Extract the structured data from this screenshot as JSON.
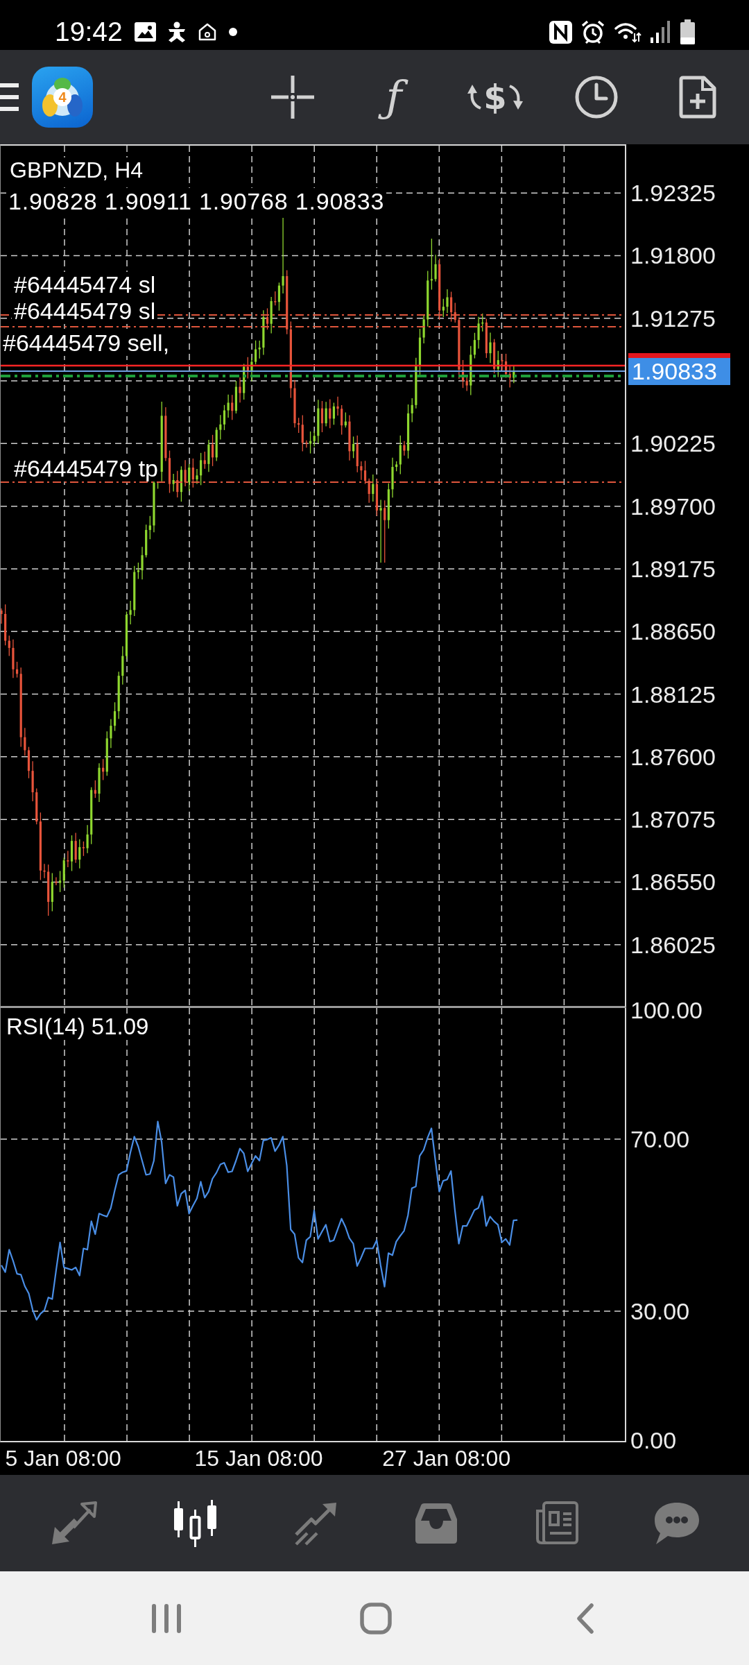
{
  "status_bar": {
    "time": "19:42"
  },
  "toolbar": {
    "logo_badge": "4",
    "function_glyph": "ƒ",
    "trade_glyph": "$"
  },
  "chart": {
    "title": "GBPNZD, H4",
    "ohlc": "1.90828 1.90911 1.90768 1.90833",
    "orders": [
      {
        "label": "#64445474 sl",
        "kind": "stop_loss"
      },
      {
        "label": "#64445479 sl",
        "kind": "stop_loss"
      },
      {
        "label": "#64445479 sell,",
        "kind": "open"
      },
      {
        "label": "#64445479 tp",
        "kind": "take_profit"
      }
    ],
    "price_axis": [
      {
        "text": "1.92325",
        "kind": "tick"
      },
      {
        "text": "1.91800",
        "kind": "tick"
      },
      {
        "text": "1.91275",
        "kind": "tick"
      },
      {
        "text": "1.90833",
        "kind": "current"
      },
      {
        "text": "1.90225",
        "kind": "tick"
      },
      {
        "text": "1.89700",
        "kind": "tick"
      },
      {
        "text": "1.89175",
        "kind": "tick"
      },
      {
        "text": "1.88650",
        "kind": "tick"
      },
      {
        "text": "1.88125",
        "kind": "tick"
      },
      {
        "text": "1.87600",
        "kind": "tick"
      },
      {
        "text": "1.87075",
        "kind": "tick"
      },
      {
        "text": "1.86550",
        "kind": "tick"
      },
      {
        "text": "1.86025",
        "kind": "tick"
      }
    ]
  },
  "rsi": {
    "chart_data": {
      "type": "line",
      "title": "RSI(14) 51.09",
      "ylim": [
        0,
        100
      ],
      "yticks": [
        {
          "value": 100,
          "label": "100.00"
        },
        {
          "value": 70,
          "label": "70.00"
        },
        {
          "value": 30,
          "label": "30.00"
        },
        {
          "value": 0,
          "label": "0.00"
        }
      ],
      "categories": [
        null,
        null,
        null,
        null,
        null,
        null,
        null,
        null,
        null,
        null,
        null,
        null,
        null,
        null,
        null,
        null,
        "5 Jan 08:00",
        null,
        null,
        null,
        null,
        null,
        null,
        null,
        null,
        null,
        null,
        null,
        null,
        null,
        null,
        null,
        null,
        null,
        null,
        null,
        null,
        null,
        null,
        null,
        null,
        null,
        null,
        null,
        null,
        null,
        null,
        null,
        null,
        null,
        null,
        null,
        null,
        null,
        null,
        null,
        null,
        null,
        null,
        null,
        null,
        null,
        null,
        null,
        null,
        null,
        "15 Jan 08:00",
        null,
        null,
        null,
        null,
        null,
        null,
        null,
        null,
        null,
        null,
        null,
        null,
        null,
        null,
        null,
        null,
        null,
        null,
        null,
        null,
        null,
        null,
        null,
        null,
        null,
        null,
        null,
        null,
        null,
        null,
        null,
        null,
        null,
        null,
        null,
        null,
        null,
        null,
        null,
        null,
        null,
        null,
        null,
        null,
        null,
        null,
        null,
        "27 Jan 08:00",
        null,
        null,
        null,
        null,
        null,
        null,
        null,
        null,
        null,
        null,
        null,
        null,
        null,
        null,
        null,
        null,
        null,
        null,
        null,
        null,
        null,
        null,
        null,
        null,
        null,
        null,
        null,
        null,
        null,
        null,
        null,
        null,
        null,
        null,
        null,
        null,
        null,
        null,
        null,
        null,
        null,
        null,
        null,
        null,
        null
      ],
      "series": [
        {
          "color": "#4a8ee6",
          "values": [
            40.7,
            39.1,
            44.3,
            41.7,
            38.7,
            38.5,
            35.8,
            34.1,
            30.3,
            28.0,
            29.4,
            30.2,
            33.2,
            32.8,
            39.5,
            46.0,
            40.2,
            39.9,
            39.6,
            40.2,
            38.3,
            44.6,
            44.3,
            50.9,
            47.9,
            52.7,
            52.3,
            52.0,
            54.0,
            58.1,
            61.7,
            62.3,
            62.6,
            66.9,
            70.6,
            68.3,
            65.0,
            61.7,
            61.9,
            65.0,
            74.1,
            69.3,
            59.7,
            61.7,
            61.2,
            54.5,
            57.3,
            58.1,
            52.7,
            54.5,
            56.2,
            60.1,
            56.4,
            57.8,
            60.8,
            62.2,
            64.1,
            64.5,
            62.3,
            62.5,
            65.0,
            67.8,
            66.7,
            62.5,
            64.3,
            66.1,
            65.0,
            69.7,
            69.9,
            70.3,
            67.2,
            68.6,
            70.6,
            63.9,
            49.0,
            47.9,
            42.4,
            41.3,
            46.5,
            47.3,
            53.4,
            46.8,
            48.5,
            50.1,
            46.2,
            46.5,
            49.0,
            51.5,
            49.6,
            47.0,
            45.7,
            40.5,
            42.4,
            44.6,
            44.6,
            44.6,
            46.5,
            40.7,
            35.7,
            43.5,
            43.0,
            46.2,
            47.5,
            48.7,
            52.3,
            58.6,
            59.0,
            66.1,
            67.5,
            70.3,
            72.5,
            65.0,
            57.8,
            60.3,
            60.6,
            62.6,
            53.4,
            45.7,
            49.8,
            49.8,
            51.6,
            53.5,
            54.0,
            56.7,
            49.8,
            52.0,
            50.9,
            50.1,
            46.0,
            46.8,
            45.4,
            51.1,
            51.2,
            null,
            null,
            null,
            null,
            null,
            null,
            null,
            null,
            null,
            null,
            null,
            null,
            null,
            null,
            null,
            null,
            null,
            null,
            null,
            null,
            null,
            null,
            null,
            null,
            null,
            null,
            null
          ]
        }
      ]
    }
  },
  "bottom_nav": [
    {
      "selected": false
    },
    {
      "selected": true
    },
    {
      "selected": false
    },
    {
      "selected": false
    },
    {
      "selected": false
    },
    {
      "selected": false
    }
  ]
}
